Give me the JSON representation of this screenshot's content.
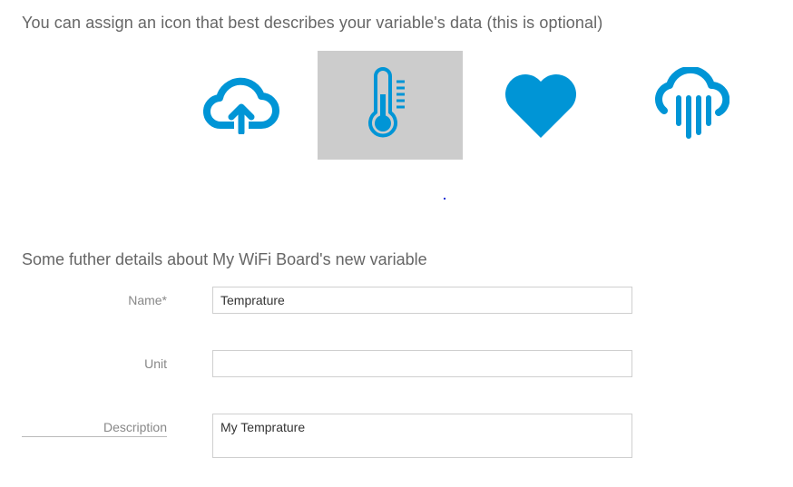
{
  "intro_text": "You can assign an icon that best describes your variable's data (this is optional)",
  "icon_choices": [
    {
      "icon": "cloud-upload-icon",
      "selected": false
    },
    {
      "icon": "thermometer-icon",
      "selected": true
    },
    {
      "icon": "heart-icon",
      "selected": false
    },
    {
      "icon": "rain-cloud-icon",
      "selected": false
    }
  ],
  "accent_color": "#0095d6",
  "selected_bg_color": "#cccccc",
  "details_title": "Some futher details about My WiFi Board's new variable",
  "form": {
    "name_label": "Name*",
    "name_value": "Temprature",
    "unit_label": "Unit",
    "unit_value": "",
    "description_label": "Description",
    "description_value": "My Temprature"
  }
}
